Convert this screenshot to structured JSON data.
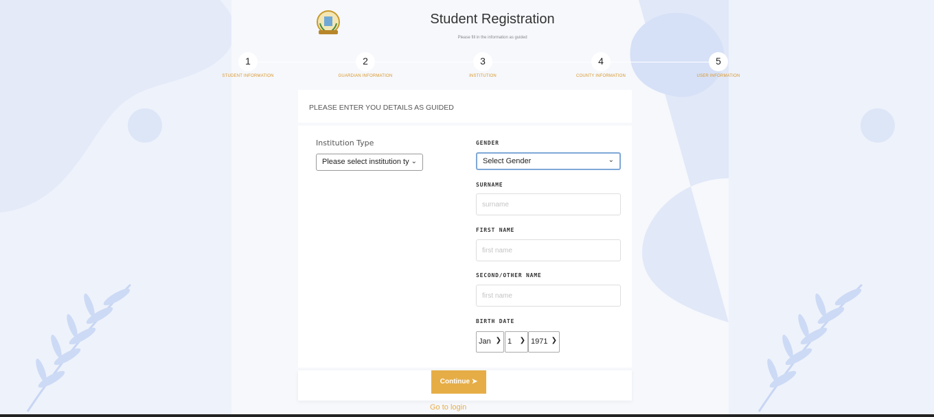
{
  "header": {
    "title": "Student Registration",
    "subtitle": "Please fill in the information as guided"
  },
  "steps": [
    {
      "num": "1",
      "label": "STUDENT INFORMATION"
    },
    {
      "num": "2",
      "label": "GUARDIAN INFORMATION"
    },
    {
      "num": "3",
      "label": "INSTITUTION"
    },
    {
      "num": "4",
      "label": "COUNTY INFORMATION"
    },
    {
      "num": "5",
      "label": "USER INFORMATION"
    }
  ],
  "card": {
    "heading": "PLEASE ENTER YOU DETAILS AS GUIDED"
  },
  "form": {
    "institution_type_label": "Institution Type",
    "institution_type_value": "Please select institution ty",
    "gender_label": "GENDER",
    "gender_value": "Select Gender",
    "surname_label": "SURNAME",
    "surname_placeholder": "surname",
    "first_name_label": "FIRST NAME",
    "first_name_placeholder": "first name",
    "second_name_label": "SECOND/OTHER NAME",
    "second_name_placeholder": "first name",
    "birth_date_label": "BIRTH DATE",
    "birth_month": "Jan",
    "birth_day": "1",
    "birth_year": "1971"
  },
  "actions": {
    "continue_label": "Continue",
    "login_link": "Go to login"
  },
  "colors": {
    "accent": "#e6ad47",
    "step_label": "#d9962a",
    "background": "#eef2fb"
  }
}
